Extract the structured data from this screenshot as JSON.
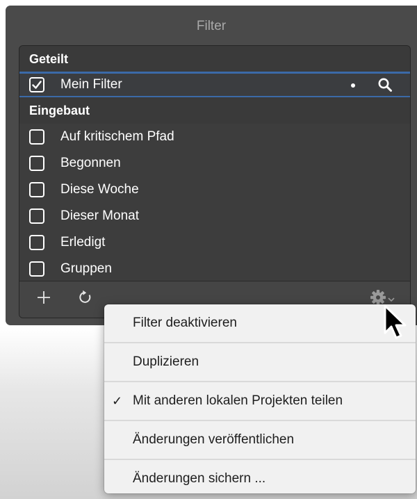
{
  "panel": {
    "title": "Filter"
  },
  "sections": [
    {
      "header": "Geteilt",
      "items": [
        {
          "label": "Mein Filter",
          "checked": true,
          "selected": true
        }
      ]
    },
    {
      "header": "Eingebaut",
      "items": [
        {
          "label": "Auf kritischem Pfad",
          "checked": false
        },
        {
          "label": "Begonnen",
          "checked": false
        },
        {
          "label": "Diese Woche",
          "checked": false
        },
        {
          "label": "Dieser Monat",
          "checked": false
        },
        {
          "label": "Erledigt",
          "checked": false
        },
        {
          "label": "Gruppen",
          "checked": false
        }
      ]
    }
  ],
  "toolbar": {
    "add_icon": "plus-icon",
    "refresh_icon": "refresh-icon",
    "action_icon": "gear-icon"
  },
  "menu": {
    "items": [
      {
        "label": "Filter deaktivieren",
        "checkmark": ""
      },
      {
        "label": "Duplizieren",
        "checkmark": ""
      },
      {
        "label": "Mit anderen lokalen Projekten teilen",
        "checkmark": "✓"
      },
      {
        "label": "Änderungen veröffentlichen",
        "checkmark": ""
      },
      {
        "label": "Änderungen sichern ...",
        "checkmark": ""
      }
    ]
  },
  "colors": {
    "panel_bg": "#4a4a4a",
    "list_bg": "#3d3d3d",
    "selection_border": "#3b6aa8",
    "menu_bg": "#f1f1f1"
  }
}
